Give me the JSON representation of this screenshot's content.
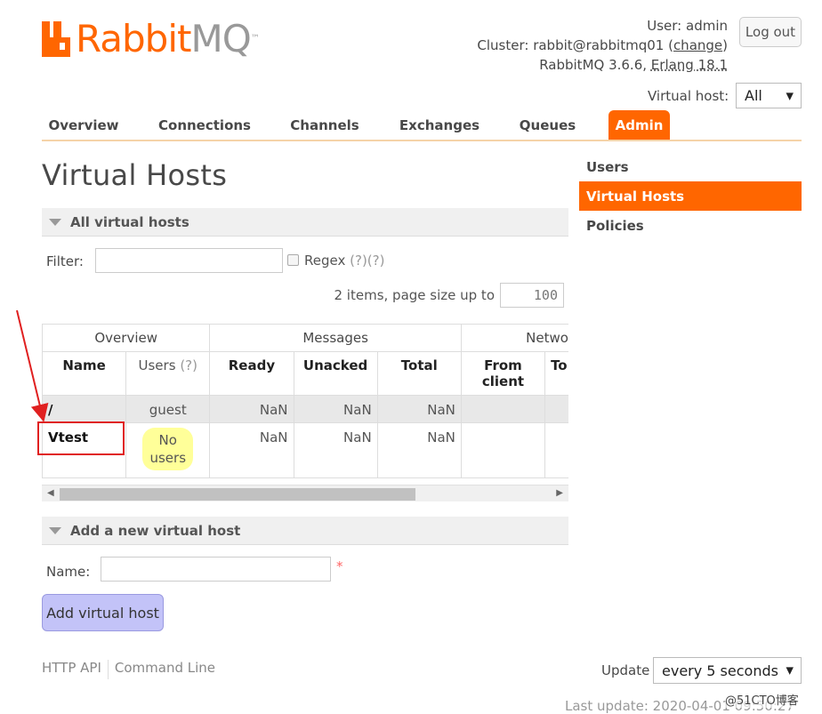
{
  "header": {
    "logo_rabbit": "Rabbit",
    "logo_mq": "MQ",
    "logo_tm": "™",
    "user_line": "User: admin",
    "cluster_prefix": "Cluster: rabbit@rabbitmq01 (",
    "cluster_change": "change",
    "cluster_suffix": ")",
    "version_prefix": "RabbitMQ 3.6.6, ",
    "version_erlang": "Erlang 18.1",
    "logout": "Log out",
    "vhost_label": "Virtual host:",
    "vhost_selected": "All"
  },
  "tabs": [
    {
      "label": "Overview"
    },
    {
      "label": "Connections"
    },
    {
      "label": "Channels"
    },
    {
      "label": "Exchanges"
    },
    {
      "label": "Queues"
    },
    {
      "label": "Admin",
      "active": true
    }
  ],
  "page_title": "Virtual Hosts",
  "sidebar": {
    "items": [
      {
        "label": "Users"
      },
      {
        "label": "Virtual Hosts",
        "active": true
      },
      {
        "label": "Policies"
      }
    ]
  },
  "all_vhosts": {
    "section_title": "All virtual hosts",
    "filter_label": "Filter:",
    "filter_value": "",
    "regex_label": "Regex",
    "regex_help": "(?)(?)",
    "items_text": "2 items, page size up to",
    "page_size": "100",
    "table": {
      "groups": [
        "Overview",
        "Messages",
        "Network"
      ],
      "columns": {
        "name": "Name",
        "users": "Users",
        "users_help": "(?)",
        "ready": "Ready",
        "unacked": "Unacked",
        "total": "Total",
        "from_client_1": "From",
        "from_client_2": "client",
        "to_client": "To client"
      },
      "rows": [
        {
          "name": "/",
          "users": "guest",
          "ready": "NaN",
          "unacked": "NaN",
          "total": "NaN"
        },
        {
          "name": "Vtest",
          "users_1": "No",
          "users_2": "users",
          "ready": "NaN",
          "unacked": "NaN",
          "total": "NaN"
        }
      ]
    }
  },
  "add_vhost": {
    "section_title": "Add a new virtual host",
    "name_label": "Name:",
    "name_value": "",
    "required_mark": "*",
    "button": "Add virtual host"
  },
  "footer": {
    "http_api": "HTTP API",
    "command_line": "Command Line",
    "update_label": "Update",
    "update_selected": "every 5 seconds",
    "last_update": "Last update: 2020-04-01 09:50:27",
    "watermark": "@51CTO博客"
  }
}
